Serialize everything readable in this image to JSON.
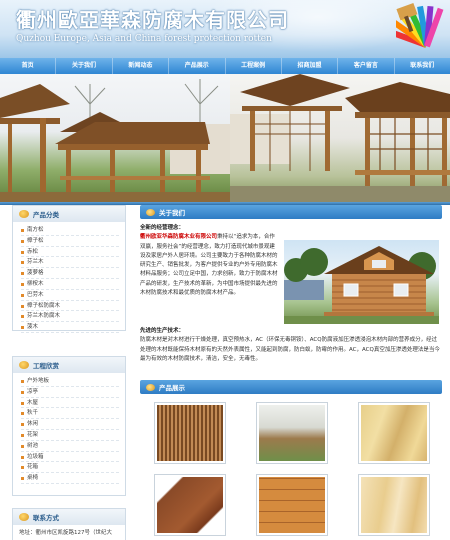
{
  "header": {
    "title_cn": "衢州歐亞華森防腐木有限公司",
    "title_en": "Quzhou Europe, Asia and China forest protection rotten"
  },
  "nav": [
    "首页",
    "关于我们",
    "新闻动态",
    "产品展示",
    "工程案例",
    "招商加盟",
    "客户留言",
    "联系我们"
  ],
  "sidebar": {
    "product_categories": {
      "title": "产品分类",
      "items": [
        "南方松",
        "樟子松",
        "赤松",
        "芬兰木",
        "菠萝格",
        "柳桉木",
        "巴劳木",
        "樟子松防腐木",
        "芬兰木防腐木",
        "菠木"
      ]
    },
    "engineering": {
      "title": "工程欣赏",
      "items": [
        "户外地板",
        "凉亭",
        "木屋",
        "秋千",
        "休闲",
        "花架",
        "树池",
        "垃圾箱",
        "花箱",
        "桌椅"
      ]
    },
    "contact": {
      "title": "联系方式",
      "address": "地址：衢州市区凯旋路127号（世纪大"
    }
  },
  "about": {
    "title": "关于我们",
    "philosophy": "全新的经营理念：",
    "company": "衢州欧亚华森防腐木业有限公司",
    "para1": "秉持以“追求为本，合作双赢，服务社会”的经营理念，致力打造现代城市景观建设及家居户外人居环境。公司主要致力于各种防腐木材的研究生产、销售批发，为客户提供专业的户外专用防腐木材料品服务；公司立足中国，力求创新，致力于防腐木材产品的研发，生产技术的革新，为中国市场提供最先进的木材防腐技术和最优质的防腐木材产品。",
    "tech_title": "先进的生产技术：",
    "para2": "防腐木材是对木材进行干燥处理，真空预热水，AC（环保无毒铜铵）、ACQ防腐液加压渗透浸泡木材内部的营养成分，经过处理的木材既能保持木材原有的天然外表属性，又能起到防腐，防白蚁，防霉的作用。AC，ACQ真空加压渗透处理法是当今最为有效的木材防腐技术，清洁，安全，无毒性。"
  },
  "products": {
    "title": "产品展示"
  },
  "colors": {
    "nav_blue": "#2f86d3",
    "accent_orange": "#e28a2a",
    "company_red": "#cc0000"
  }
}
